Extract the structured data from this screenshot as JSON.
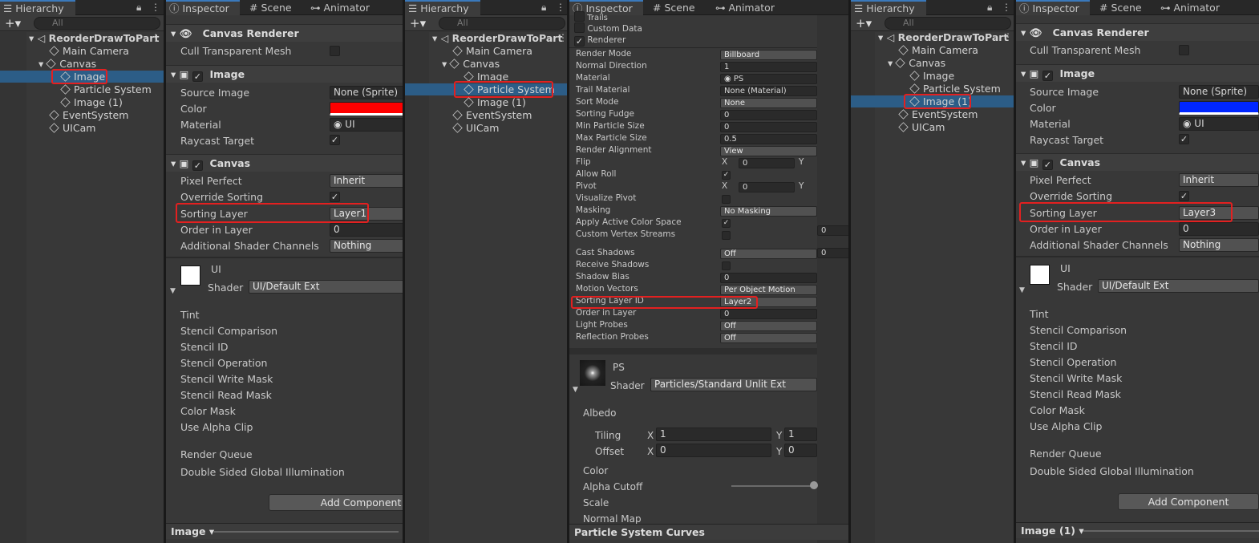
{
  "hierarchy": {
    "tab": "Hierarchy",
    "search_placeholder": "All",
    "scene": "ReorderDrawToPart",
    "items": [
      "Main Camera",
      "Canvas",
      "Image",
      "Particle System",
      "Image (1)",
      "EventSystem",
      "UICam"
    ]
  },
  "tabs": {
    "inspector": "Inspector",
    "scene": "Scene",
    "animator": "Animator"
  },
  "canvas_renderer": {
    "title": "Canvas Renderer",
    "cull_label": "Cull Transparent Mesh"
  },
  "image": {
    "title": "Image",
    "source_label": "Source Image",
    "source_value": "None (Sprite)",
    "color_label": "Color",
    "material_label": "Material",
    "material_value": "UI",
    "raycast_label": "Raycast Target"
  },
  "canvas": {
    "title": "Canvas",
    "pixel_label": "Pixel Perfect",
    "pixel_value": "Inherit",
    "override_label": "Override Sorting",
    "sorting_label": "Sorting Layer",
    "order_label": "Order in Layer",
    "order_value": "0",
    "shader_ch_label": "Additional Shader Channels",
    "shader_ch_value": "Nothing"
  },
  "material": {
    "name": "UI",
    "shader_label": "Shader",
    "shader_value": "UI/Default Ext",
    "props": [
      "Tint",
      "Stencil Comparison",
      "Stencil ID",
      "Stencil Operation",
      "Stencil Write Mask",
      "Stencil Read Mask",
      "Color Mask",
      "Use Alpha Clip"
    ],
    "render_queue": "Render Queue",
    "double_sided": "Double Sided Global Illumination"
  },
  "add_component": "Add Component",
  "inspector1": {
    "sorting_value": "Layer1",
    "color": "#ff0000",
    "footer": "Image"
  },
  "inspector3": {
    "sorting_value": "Layer3",
    "color": "#0026ff",
    "footer": "Image (1)"
  },
  "particle": {
    "top_labels": [
      "Trails",
      "Custom Data",
      "Renderer"
    ],
    "rows": [
      {
        "l": "Render Mode",
        "v": "Billboard"
      },
      {
        "l": "Normal Direction",
        "v": "1"
      },
      {
        "l": "Material",
        "v": "PS"
      },
      {
        "l": "Trail Material",
        "v": "None (Material)"
      },
      {
        "l": "Sort Mode",
        "v": "None"
      },
      {
        "l": "Sorting Fudge",
        "v": "0"
      },
      {
        "l": "Min Particle Size",
        "v": "0"
      },
      {
        "l": "Max Particle Size",
        "v": "0.5"
      },
      {
        "l": "Render Alignment",
        "v": "View"
      },
      {
        "l": "Flip",
        "v": ""
      },
      {
        "l": "Allow Roll",
        "v": ""
      },
      {
        "l": "Pivot",
        "v": ""
      },
      {
        "l": "Visualize Pivot",
        "v": ""
      },
      {
        "l": "Masking",
        "v": "No Masking"
      },
      {
        "l": "Apply Active Color Space",
        "v": ""
      },
      {
        "l": "Custom Vertex Streams",
        "v": ""
      }
    ],
    "rows2": [
      {
        "l": "Cast Shadows",
        "v": "Off"
      },
      {
        "l": "Receive Shadows",
        "v": ""
      },
      {
        "l": "Shadow Bias",
        "v": "0"
      },
      {
        "l": "Motion Vectors",
        "v": "Per Object Motion"
      },
      {
        "l": "Sorting Layer ID",
        "v": "Layer2"
      },
      {
        "l": "Order in Layer",
        "v": "0"
      },
      {
        "l": "Light Probes",
        "v": "Off"
      },
      {
        "l": "Reflection Probes",
        "v": "Off"
      }
    ],
    "xyz": {
      "x": "X",
      "y": "Y",
      "zero": "0"
    },
    "side_zero": "0",
    "mat_name": "PS",
    "shader_label": "Shader",
    "shader_value": "Particles/Standard Unlit Ext",
    "albedo": "Albedo",
    "tiling": "Tiling",
    "offset": "Offset",
    "tiling_x": "1",
    "tiling_y": "1",
    "offset_x": "0",
    "offset_y": "0",
    "color": "Color",
    "alpha_cutoff": "Alpha Cutoff",
    "scale": "Scale",
    "normal_map": "Normal Map",
    "footer": "Particle System Curves"
  }
}
